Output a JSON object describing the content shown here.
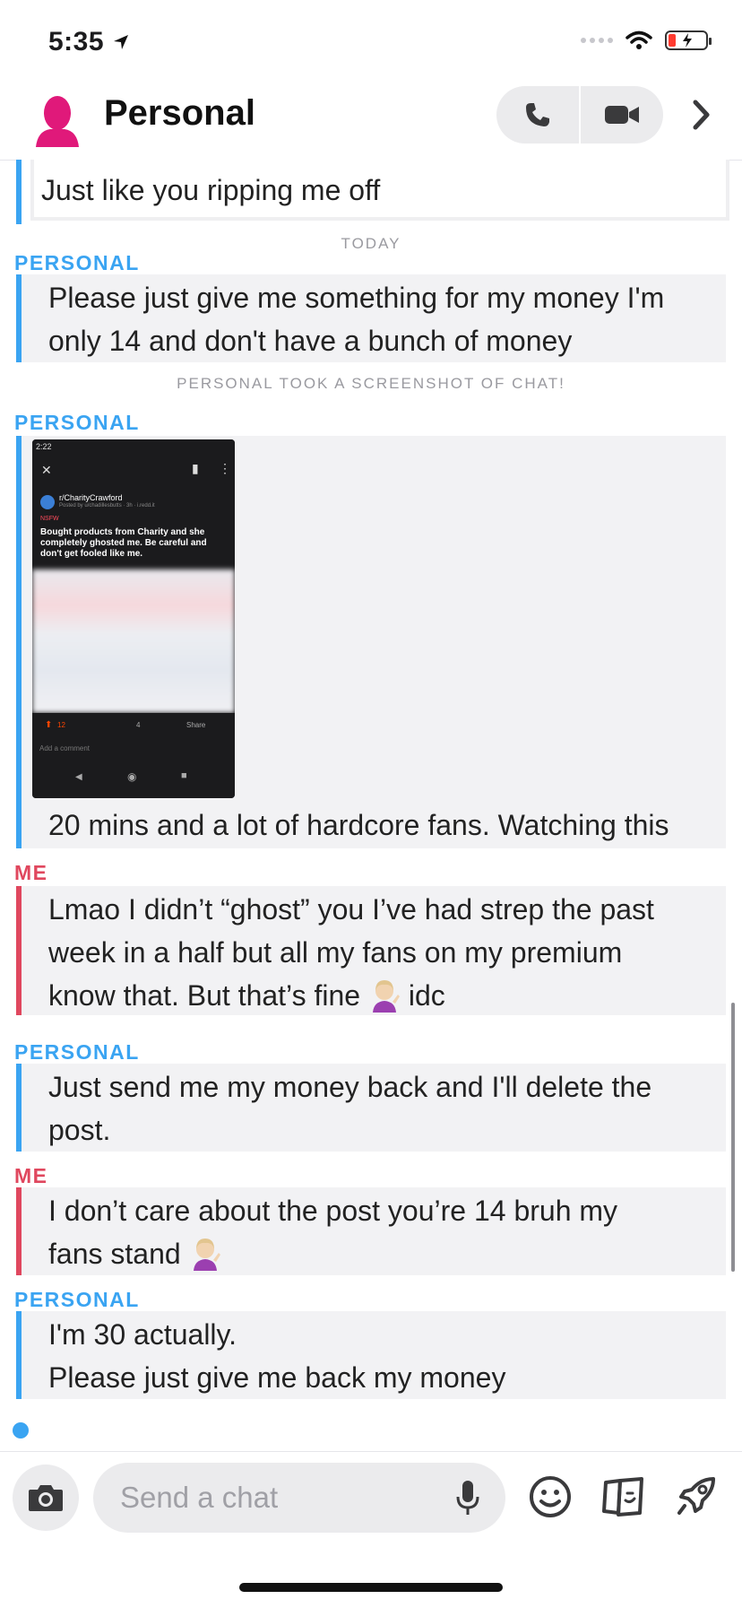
{
  "status_bar": {
    "time": "5:35"
  },
  "header": {
    "title": "Personal"
  },
  "chat": {
    "partial_message": "Just like you ripping me off",
    "day_divider": "TODAY",
    "screenshot_notice": "PERSONAL TOOK A SCREENSHOT OF CHAT!",
    "messages": [
      {
        "sender": "PERSONAL",
        "lines": [
          "Please just give me something for my money I'm",
          "only 14 and don't have a bunch of money"
        ]
      },
      {
        "sender": "PERSONAL",
        "lines": [
          "20 mins and a lot of hardcore fans. Watching this"
        ]
      },
      {
        "sender": "ME",
        "lines": [
          "Lmao I didn’t “ghost” you I’ve had strep the past",
          "week in a half but all my fans on my premium",
          "know that. But that’s fine",
          "idc"
        ]
      },
      {
        "sender": "PERSONAL",
        "lines": [
          "Just send me my money back and I'll delete the",
          "post."
        ]
      },
      {
        "sender": "ME",
        "lines": [
          "I don’t care about the post you’re 14 bruh my",
          "fans stand"
        ]
      },
      {
        "sender": "PERSONAL",
        "lines": [
          "I'm 30 actually.",
          "Please just give me back my money"
        ]
      }
    ],
    "shared_image": {
      "time": "2:22",
      "subreddit": "r/CharityCrawford",
      "posted_by": "Posted by u/chadillesbutts · 3h · i.redd.it",
      "tag": "NSFW",
      "post_title": "Bought products from Charity and she completely ghosted me. Be careful and don't get fooled like me.",
      "upvotes": "12",
      "comments": "4",
      "share": "Share",
      "comment_placeholder": "Add a comment"
    }
  },
  "input": {
    "placeholder": "Send a chat"
  },
  "colors": {
    "personal": "#3aa4f2",
    "me": "#e0475e",
    "avatar": "#e0197a"
  },
  "icons": [
    "phone-icon",
    "video-icon",
    "chevron-right-icon",
    "camera-icon",
    "mic-icon",
    "smiley-icon",
    "cards-icon",
    "rocket-icon"
  ]
}
